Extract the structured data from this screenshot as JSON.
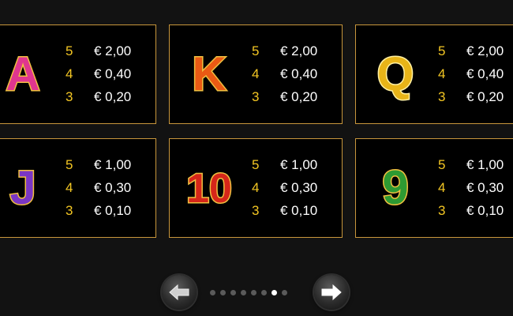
{
  "paytable": {
    "cards": [
      {
        "symbol": "A",
        "symbol_color": "#e0368f",
        "payouts": [
          {
            "count": "5",
            "value": "€ 2,00"
          },
          {
            "count": "4",
            "value": "€ 0,40"
          },
          {
            "count": "3",
            "value": "€ 0,20"
          }
        ]
      },
      {
        "symbol": "K",
        "symbol_color": "#ea5a14",
        "payouts": [
          {
            "count": "5",
            "value": "€ 2,00"
          },
          {
            "count": "4",
            "value": "€ 0,40"
          },
          {
            "count": "3",
            "value": "€ 0,20"
          }
        ]
      },
      {
        "symbol": "Q",
        "symbol_color": "#e8b418",
        "payouts": [
          {
            "count": "5",
            "value": "€ 2,00"
          },
          {
            "count": "4",
            "value": "€ 0,40"
          },
          {
            "count": "3",
            "value": "€ 0,20"
          }
        ]
      },
      {
        "symbol": "J",
        "symbol_color": "#7a36c4",
        "payouts": [
          {
            "count": "5",
            "value": "€ 1,00"
          },
          {
            "count": "4",
            "value": "€ 0,30"
          },
          {
            "count": "3",
            "value": "€ 0,10"
          }
        ]
      },
      {
        "symbol": "10",
        "symbol_color": "#d6261a",
        "payouts": [
          {
            "count": "5",
            "value": "€ 1,00"
          },
          {
            "count": "4",
            "value": "€ 0,30"
          },
          {
            "count": "3",
            "value": "€ 0,10"
          }
        ]
      },
      {
        "symbol": "9",
        "symbol_color": "#2e9a32",
        "payouts": [
          {
            "count": "5",
            "value": "€ 1,00"
          },
          {
            "count": "4",
            "value": "€ 0,30"
          },
          {
            "count": "3",
            "value": "€ 0,10"
          }
        ]
      }
    ]
  },
  "navigation": {
    "prev_icon": "arrow-left-icon",
    "next_icon": "arrow-right-icon",
    "total_pages": 8,
    "current_page": 7
  },
  "colors": {
    "background": "#121212",
    "card_border": "#c8963c",
    "count_text": "#f3c623",
    "value_text": "#ffffff",
    "symbol_outline": "#f0c040"
  }
}
